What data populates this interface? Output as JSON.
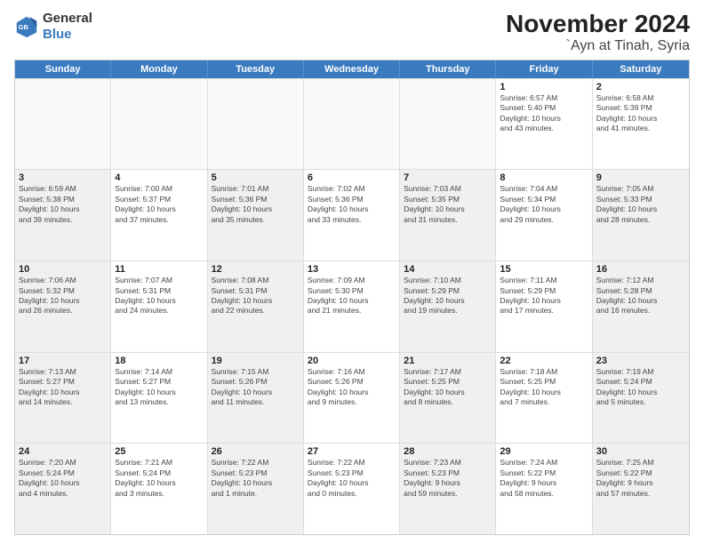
{
  "logo": {
    "line1": "General",
    "line2": "Blue"
  },
  "header": {
    "month": "November 2024",
    "location": "`Ayn at Tinah, Syria"
  },
  "weekdays": [
    "Sunday",
    "Monday",
    "Tuesday",
    "Wednesday",
    "Thursday",
    "Friday",
    "Saturday"
  ],
  "rows": [
    [
      {
        "day": "",
        "info": "",
        "empty": true
      },
      {
        "day": "",
        "info": "",
        "empty": true
      },
      {
        "day": "",
        "info": "",
        "empty": true
      },
      {
        "day": "",
        "info": "",
        "empty": true
      },
      {
        "day": "",
        "info": "",
        "empty": true
      },
      {
        "day": "1",
        "info": "Sunrise: 6:57 AM\nSunset: 5:40 PM\nDaylight: 10 hours\nand 43 minutes."
      },
      {
        "day": "2",
        "info": "Sunrise: 6:58 AM\nSunset: 5:39 PM\nDaylight: 10 hours\nand 41 minutes."
      }
    ],
    [
      {
        "day": "3",
        "info": "Sunrise: 6:59 AM\nSunset: 5:38 PM\nDaylight: 10 hours\nand 39 minutes.",
        "shaded": true
      },
      {
        "day": "4",
        "info": "Sunrise: 7:00 AM\nSunset: 5:37 PM\nDaylight: 10 hours\nand 37 minutes."
      },
      {
        "day": "5",
        "info": "Sunrise: 7:01 AM\nSunset: 5:36 PM\nDaylight: 10 hours\nand 35 minutes.",
        "shaded": true
      },
      {
        "day": "6",
        "info": "Sunrise: 7:02 AM\nSunset: 5:36 PM\nDaylight: 10 hours\nand 33 minutes."
      },
      {
        "day": "7",
        "info": "Sunrise: 7:03 AM\nSunset: 5:35 PM\nDaylight: 10 hours\nand 31 minutes.",
        "shaded": true
      },
      {
        "day": "8",
        "info": "Sunrise: 7:04 AM\nSunset: 5:34 PM\nDaylight: 10 hours\nand 29 minutes."
      },
      {
        "day": "9",
        "info": "Sunrise: 7:05 AM\nSunset: 5:33 PM\nDaylight: 10 hours\nand 28 minutes.",
        "shaded": true
      }
    ],
    [
      {
        "day": "10",
        "info": "Sunrise: 7:06 AM\nSunset: 5:32 PM\nDaylight: 10 hours\nand 26 minutes.",
        "shaded": true
      },
      {
        "day": "11",
        "info": "Sunrise: 7:07 AM\nSunset: 5:31 PM\nDaylight: 10 hours\nand 24 minutes."
      },
      {
        "day": "12",
        "info": "Sunrise: 7:08 AM\nSunset: 5:31 PM\nDaylight: 10 hours\nand 22 minutes.",
        "shaded": true
      },
      {
        "day": "13",
        "info": "Sunrise: 7:09 AM\nSunset: 5:30 PM\nDaylight: 10 hours\nand 21 minutes."
      },
      {
        "day": "14",
        "info": "Sunrise: 7:10 AM\nSunset: 5:29 PM\nDaylight: 10 hours\nand 19 minutes.",
        "shaded": true
      },
      {
        "day": "15",
        "info": "Sunrise: 7:11 AM\nSunset: 5:29 PM\nDaylight: 10 hours\nand 17 minutes."
      },
      {
        "day": "16",
        "info": "Sunrise: 7:12 AM\nSunset: 5:28 PM\nDaylight: 10 hours\nand 16 minutes.",
        "shaded": true
      }
    ],
    [
      {
        "day": "17",
        "info": "Sunrise: 7:13 AM\nSunset: 5:27 PM\nDaylight: 10 hours\nand 14 minutes.",
        "shaded": true
      },
      {
        "day": "18",
        "info": "Sunrise: 7:14 AM\nSunset: 5:27 PM\nDaylight: 10 hours\nand 13 minutes."
      },
      {
        "day": "19",
        "info": "Sunrise: 7:15 AM\nSunset: 5:26 PM\nDaylight: 10 hours\nand 11 minutes.",
        "shaded": true
      },
      {
        "day": "20",
        "info": "Sunrise: 7:16 AM\nSunset: 5:26 PM\nDaylight: 10 hours\nand 9 minutes."
      },
      {
        "day": "21",
        "info": "Sunrise: 7:17 AM\nSunset: 5:25 PM\nDaylight: 10 hours\nand 8 minutes.",
        "shaded": true
      },
      {
        "day": "22",
        "info": "Sunrise: 7:18 AM\nSunset: 5:25 PM\nDaylight: 10 hours\nand 7 minutes."
      },
      {
        "day": "23",
        "info": "Sunrise: 7:19 AM\nSunset: 5:24 PM\nDaylight: 10 hours\nand 5 minutes.",
        "shaded": true
      }
    ],
    [
      {
        "day": "24",
        "info": "Sunrise: 7:20 AM\nSunset: 5:24 PM\nDaylight: 10 hours\nand 4 minutes.",
        "shaded": true
      },
      {
        "day": "25",
        "info": "Sunrise: 7:21 AM\nSunset: 5:24 PM\nDaylight: 10 hours\nand 3 minutes."
      },
      {
        "day": "26",
        "info": "Sunrise: 7:22 AM\nSunset: 5:23 PM\nDaylight: 10 hours\nand 1 minute.",
        "shaded": true
      },
      {
        "day": "27",
        "info": "Sunrise: 7:22 AM\nSunset: 5:23 PM\nDaylight: 10 hours\nand 0 minutes."
      },
      {
        "day": "28",
        "info": "Sunrise: 7:23 AM\nSunset: 5:23 PM\nDaylight: 9 hours\nand 59 minutes.",
        "shaded": true
      },
      {
        "day": "29",
        "info": "Sunrise: 7:24 AM\nSunset: 5:22 PM\nDaylight: 9 hours\nand 58 minutes."
      },
      {
        "day": "30",
        "info": "Sunrise: 7:25 AM\nSunset: 5:22 PM\nDaylight: 9 hours\nand 57 minutes.",
        "shaded": true
      }
    ]
  ]
}
